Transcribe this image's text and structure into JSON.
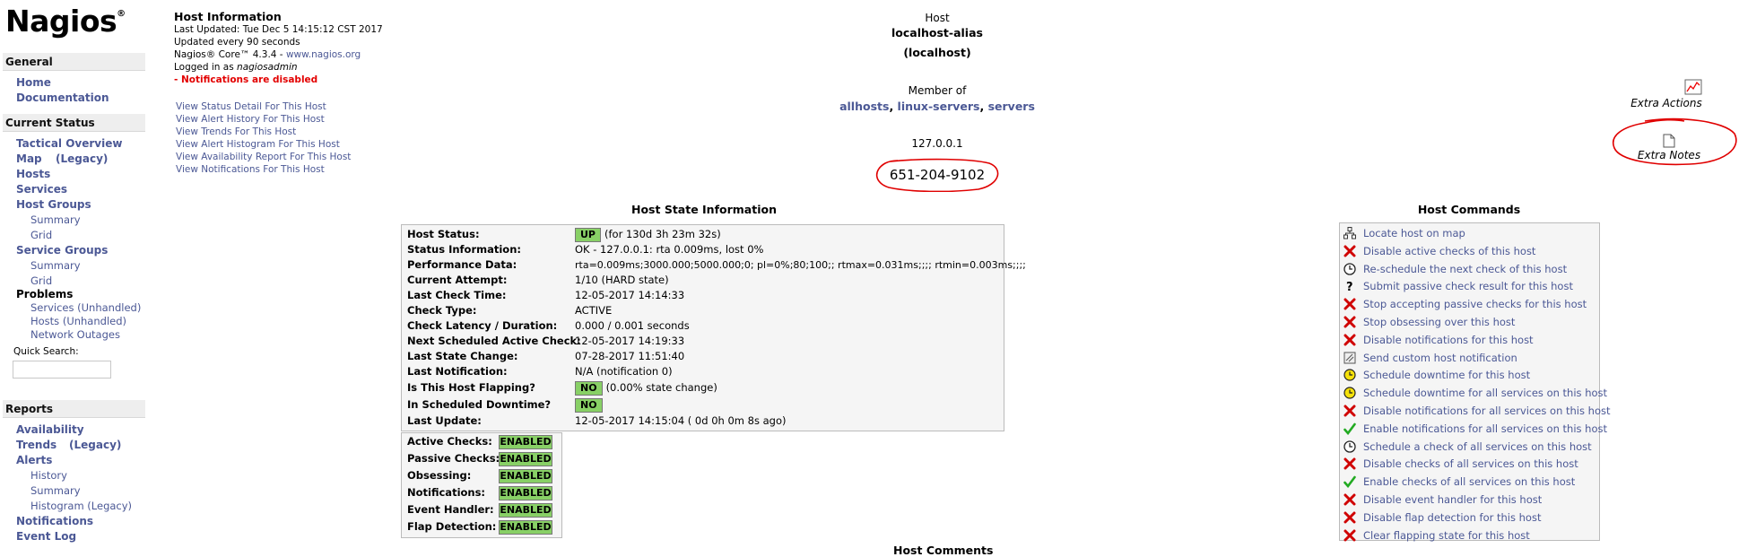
{
  "sidebar": {
    "logo": "Nagios",
    "logo_mark": "®",
    "sections": {
      "general": "General",
      "current_status": "Current Status",
      "reports": "Reports"
    },
    "general_items": [
      "Home",
      "Documentation"
    ],
    "current_status_items": {
      "tactical_overview": "Tactical Overview",
      "map": "Map",
      "map_legacy": "(Legacy)",
      "hosts": "Hosts",
      "services": "Services",
      "host_groups": "Host Groups",
      "hg_summary": "Summary",
      "hg_grid": "Grid",
      "service_groups": "Service Groups",
      "sg_summary": "Summary",
      "sg_grid": "Grid",
      "problems": "Problems",
      "services_unhandled": "Services (Unhandled)",
      "hosts_unhandled": "Hosts (Unhandled)",
      "network_outages": "Network Outages"
    },
    "quick_search_label": "Quick Search:",
    "quick_search_value": "",
    "reports_items": {
      "availability": "Availability",
      "trends": "Trends",
      "trends_legacy": "(Legacy)",
      "alerts": "Alerts",
      "history": "History",
      "summary": "Summary",
      "histogram": "Histogram (Legacy)",
      "notifications": "Notifications",
      "event_log": "Event Log"
    }
  },
  "info": {
    "title": "Host Information",
    "last_updated": "Last Updated: Tue Dec 5 14:15:12 CST 2017",
    "update_interval": "Updated every 90 seconds",
    "version_prefix": "Nagios® Core™ 4.3.4 - ",
    "version_link": "www.nagios.org",
    "logged_in_prefix": "Logged in as ",
    "logged_in_user": "nagiosadmin",
    "notifications_warning": "- Notifications are disabled",
    "links": [
      "View Status Detail For This Host",
      "View Alert History For This Host",
      "View Trends For This Host",
      "View Alert Histogram For This Host",
      "View Availability Report For This Host",
      "View Notifications For This Host"
    ]
  },
  "host": {
    "label": "Host",
    "alias": "localhost-alias",
    "name": "(localhost)",
    "member_of_label": "Member of",
    "groups": [
      "allhosts",
      "linux-servers",
      "servers"
    ],
    "group_sep": ", ",
    "address": "127.0.0.1",
    "phone": "651-204-9102"
  },
  "extras": {
    "actions": "Extra Actions",
    "notes": "Extra Notes"
  },
  "state": {
    "title": "Host State Information",
    "rows": [
      {
        "k": "Host Status:",
        "badge": "UP",
        "v": "(for 130d 3h 23m 32s)"
      },
      {
        "k": "Status Information:",
        "v": "OK - 127.0.0.1: rta 0.009ms, lost 0%"
      },
      {
        "k": "Performance Data:",
        "v": "rta=0.009ms;3000.000;5000.000;0; pl=0%;80;100;; rtmax=0.031ms;;;; rtmin=0.003ms;;;;"
      },
      {
        "k": "Current Attempt:",
        "v": "1/10  (HARD state)"
      },
      {
        "k": "Last Check Time:",
        "v": "12-05-2017 14:14:33"
      },
      {
        "k": "Check Type:",
        "v": "ACTIVE"
      },
      {
        "k": "Check Latency / Duration:",
        "v": "0.000 / 0.001 seconds"
      },
      {
        "k": "Next Scheduled Active Check:",
        "v": "12-05-2017 14:19:33"
      },
      {
        "k": "Last State Change:",
        "v": "07-28-2017 11:51:40"
      },
      {
        "k": "Last Notification:",
        "v": "N/A (notification 0)"
      },
      {
        "k": "Is This Host Flapping?",
        "badge": "NO",
        "v": "(0.00% state change)"
      },
      {
        "k": "In Scheduled Downtime?",
        "badge": "NO",
        "v": ""
      },
      {
        "k": "Last Update:",
        "v": "12-05-2017 14:15:04  ( 0d 0h 0m 8s ago)"
      }
    ]
  },
  "checks": [
    {
      "k": "Active Checks:",
      "v": "ENABLED"
    },
    {
      "k": "Passive Checks:",
      "v": "ENABLED"
    },
    {
      "k": "Obsessing:",
      "v": "ENABLED"
    },
    {
      "k": "Notifications:",
      "v": "ENABLED"
    },
    {
      "k": "Event Handler:",
      "v": "ENABLED"
    },
    {
      "k": "Flap Detection:",
      "v": "ENABLED"
    }
  ],
  "host_comments_title": "Host Comments",
  "commands": {
    "title": "Host Commands",
    "items": [
      {
        "icon": "map-icon",
        "label": "Locate host on map"
      },
      {
        "icon": "red-x-icon",
        "label": "Disable active checks of this host"
      },
      {
        "icon": "clock-icon",
        "label": "Re-schedule the next check of this host"
      },
      {
        "icon": "question-icon",
        "label": "Submit passive check result for this host"
      },
      {
        "icon": "red-x-icon",
        "label": "Stop accepting passive checks for this host"
      },
      {
        "icon": "red-x-icon",
        "label": "Stop obsessing over this host"
      },
      {
        "icon": "red-x-icon",
        "label": "Disable notifications for this host"
      },
      {
        "icon": "notify-icon",
        "label": "Send custom host notification"
      },
      {
        "icon": "downtime-icon",
        "label": "Schedule downtime for this host"
      },
      {
        "icon": "downtime-icon",
        "label": "Schedule downtime for all services on this host"
      },
      {
        "icon": "red-x-icon",
        "label": "Disable notifications for all services on this host"
      },
      {
        "icon": "checkmark-icon",
        "label": "Enable notifications for all services on this host"
      },
      {
        "icon": "clock-icon",
        "label": "Schedule a check of all services on this host"
      },
      {
        "icon": "red-x-icon",
        "label": "Disable checks of all services on this host"
      },
      {
        "icon": "checkmark-icon",
        "label": "Enable checks of all services on this host"
      },
      {
        "icon": "red-x-icon",
        "label": "Disable event handler for this host"
      },
      {
        "icon": "red-x-icon",
        "label": "Disable flap detection for this host"
      },
      {
        "icon": "red-x-icon",
        "label": "Clear flapping state for this host"
      }
    ]
  },
  "colors": {
    "link": "#4b5895",
    "badge_green": "#88d066",
    "warning_red": "#e30000",
    "annotation_red": "#e00000"
  }
}
